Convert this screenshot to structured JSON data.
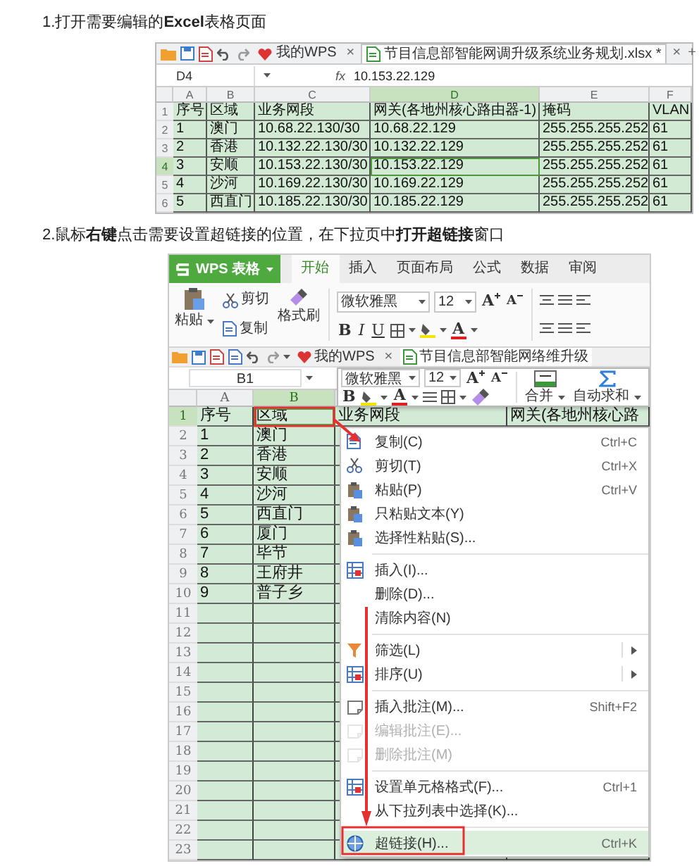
{
  "step_1": {
    "caption": "1.打开需要编辑的**Excel**表格页面",
    "screenshot": {
      "document_tabs": [
        {
          "label": "我的WPS",
          "close": "×",
          "selected": false
        },
        {
          "label": "节目信息部智能网调升级系统业务规划.xlsx *",
          "close": "×",
          "selected": true
        }
      ],
      "new_tab": "+",
      "name_box": "D4",
      "fx": "fx",
      "formula": "10.153.22.129",
      "columns": [
        {
          "label": "A",
          "selected": false
        },
        {
          "label": "B",
          "selected": false
        },
        {
          "label": "C",
          "selected": false
        },
        {
          "label": "D",
          "selected": true
        },
        {
          "label": "E",
          "selected": false
        },
        {
          "label": "F",
          "selected": false
        }
      ],
      "rows": [
        {
          "number": "1",
          "selected": false,
          "cells": [
            "序号",
            "区域",
            "业务网段",
            "网关(各地州核心路由器-1)",
            "掩码",
            "VLAN"
          ]
        },
        {
          "number": "2",
          "selected": false,
          "cells": [
            "1",
            "澳门",
            "10.68.22.130/30",
            "10.68.22.129",
            "255.255.255.252",
            "61"
          ]
        },
        {
          "number": "3",
          "selected": false,
          "cells": [
            "2",
            "香港",
            "10.132.22.130/30",
            "10.132.22.129",
            "255.255.255.252",
            "61"
          ]
        },
        {
          "number": "4",
          "selected": true,
          "cells": [
            "3",
            "安顺",
            "10.153.22.130/30",
            "10.153.22.129",
            "255.255.255.252",
            "61"
          ]
        },
        {
          "number": "5",
          "selected": false,
          "cells": [
            "4",
            "沙河",
            "10.169.22.130/30",
            "10.169.22.129",
            "255.255.255.252",
            "61"
          ]
        },
        {
          "number": "6",
          "selected": false,
          "cells": [
            "5",
            "西直门",
            "10.185.22.130/30",
            "10.185.22.129",
            "255.255.255.252",
            "61"
          ]
        }
      ]
    }
  },
  "step_2": {
    "caption": "2.鼠标**右键**点击需要设置超链接的位置，在下拉页中**打开超链接**窗口",
    "screenshot": {
      "app_button": "WPS 表格",
      "ribbon_tabs": [
        {
          "label": "开始",
          "selected": true
        },
        {
          "label": "插入",
          "selected": false
        },
        {
          "label": "页面布局",
          "selected": false
        },
        {
          "label": "公式",
          "selected": false
        },
        {
          "label": "数据",
          "selected": false
        },
        {
          "label": "审阅",
          "selected": false
        }
      ],
      "ribbon": {
        "paste": "粘贴",
        "cut": "剪切",
        "copy": "复制",
        "format_painter": "格式刷",
        "font": "微软雅黑",
        "font_size": "12",
        "grow_font": "A",
        "shrink_font": "A",
        "bold": "B",
        "italic": "I",
        "underline": "U",
        "font_color": "A"
      },
      "document_tabs": [
        {
          "label": "我的WPS",
          "close": "×",
          "selected": false
        },
        {
          "label": "节目信息部智能网络维升级",
          "selected": true
        }
      ],
      "name_box": "B1",
      "mini_toolbar": {
        "font": "微软雅黑",
        "font_size": "12",
        "grow_font": "A",
        "shrink_font": "A",
        "bold": "B",
        "font_color": "A",
        "merge": "合并",
        "autosum": "自动求和"
      },
      "columns": [
        {
          "label": "A",
          "selected": false
        },
        {
          "label": "B",
          "selected": true
        }
      ],
      "rows": [
        {
          "number": "1",
          "selected": true,
          "cells": [
            "序号",
            "区域",
            "业务网段",
            "网关(各地州核心路"
          ]
        },
        {
          "number": "2",
          "selected": false,
          "cells": [
            "1",
            "澳门"
          ]
        },
        {
          "number": "3",
          "selected": false,
          "cells": [
            "2",
            "香港"
          ]
        },
        {
          "number": "4",
          "selected": false,
          "cells": [
            "3",
            "安顺"
          ]
        },
        {
          "number": "5",
          "selected": false,
          "cells": [
            "4",
            "沙河"
          ]
        },
        {
          "number": "6",
          "selected": false,
          "cells": [
            "5",
            "西直门"
          ]
        },
        {
          "number": "7",
          "selected": false,
          "cells": [
            "6",
            "厦门"
          ]
        },
        {
          "number": "8",
          "selected": false,
          "cells": [
            "7",
            "毕节"
          ]
        },
        {
          "number": "9",
          "selected": false,
          "cells": [
            "8",
            "王府井"
          ]
        },
        {
          "number": "10",
          "selected": false,
          "cells": [
            "9",
            "普子乡"
          ]
        },
        {
          "number": "11",
          "selected": false
        },
        {
          "number": "12",
          "selected": false
        },
        {
          "number": "13",
          "selected": false
        },
        {
          "number": "14",
          "selected": false
        },
        {
          "number": "15",
          "selected": false
        },
        {
          "number": "16",
          "selected": false
        },
        {
          "number": "17",
          "selected": false
        },
        {
          "number": "18",
          "selected": false
        },
        {
          "number": "19",
          "selected": false
        },
        {
          "number": "20",
          "selected": false
        },
        {
          "number": "21",
          "selected": false
        },
        {
          "number": "22",
          "selected": false
        },
        {
          "number": "23",
          "selected": false
        }
      ],
      "context_menu": [
        {
          "kind": "item",
          "label": "复制(C)",
          "shortcut": "Ctrl+C",
          "disabled": false,
          "submenu": false,
          "highlighted": false
        },
        {
          "kind": "item",
          "label": "剪切(T)",
          "shortcut": "Ctrl+X",
          "disabled": false,
          "submenu": false,
          "highlighted": false
        },
        {
          "kind": "item",
          "label": "粘贴(P)",
          "shortcut": "Ctrl+V",
          "disabled": false,
          "submenu": false,
          "highlighted": false
        },
        {
          "kind": "item",
          "label": "只粘贴文本(Y)",
          "disabled": false,
          "submenu": false,
          "highlighted": false
        },
        {
          "kind": "item",
          "label": "选择性粘贴(S)...",
          "disabled": false,
          "submenu": false,
          "highlighted": false
        },
        {
          "kind": "separator"
        },
        {
          "kind": "item",
          "label": "插入(I)...",
          "disabled": false,
          "submenu": false,
          "highlighted": false
        },
        {
          "kind": "item",
          "label": "删除(D)...",
          "disabled": false,
          "submenu": false,
          "highlighted": false
        },
        {
          "kind": "item",
          "label": "清除内容(N)",
          "disabled": false,
          "submenu": false,
          "highlighted": false
        },
        {
          "kind": "separator"
        },
        {
          "kind": "item",
          "label": "筛选(L)",
          "disabled": false,
          "submenu": true,
          "highlighted": false
        },
        {
          "kind": "item",
          "label": "排序(U)",
          "disabled": false,
          "submenu": true,
          "highlighted": false
        },
        {
          "kind": "separator"
        },
        {
          "kind": "item",
          "label": "插入批注(M)...",
          "shortcut": "Shift+F2",
          "disabled": false,
          "submenu": false,
          "highlighted": false
        },
        {
          "kind": "item",
          "label": "编辑批注(E)...",
          "disabled": true,
          "submenu": false,
          "highlighted": false
        },
        {
          "kind": "item",
          "label": "删除批注(M)",
          "disabled": true,
          "submenu": false,
          "highlighted": false
        },
        {
          "kind": "separator"
        },
        {
          "kind": "item",
          "label": "设置单元格格式(F)...",
          "shortcut": "Ctrl+1",
          "disabled": false,
          "submenu": false,
          "highlighted": false
        },
        {
          "kind": "item",
          "label": "从下拉列表中选择(K)...",
          "disabled": false,
          "submenu": false,
          "highlighted": false
        },
        {
          "kind": "separator"
        },
        {
          "kind": "item",
          "label": "超链接(H)...",
          "shortcut": "Ctrl+K",
          "disabled": false,
          "submenu": false,
          "highlighted": true
        }
      ]
    }
  }
}
